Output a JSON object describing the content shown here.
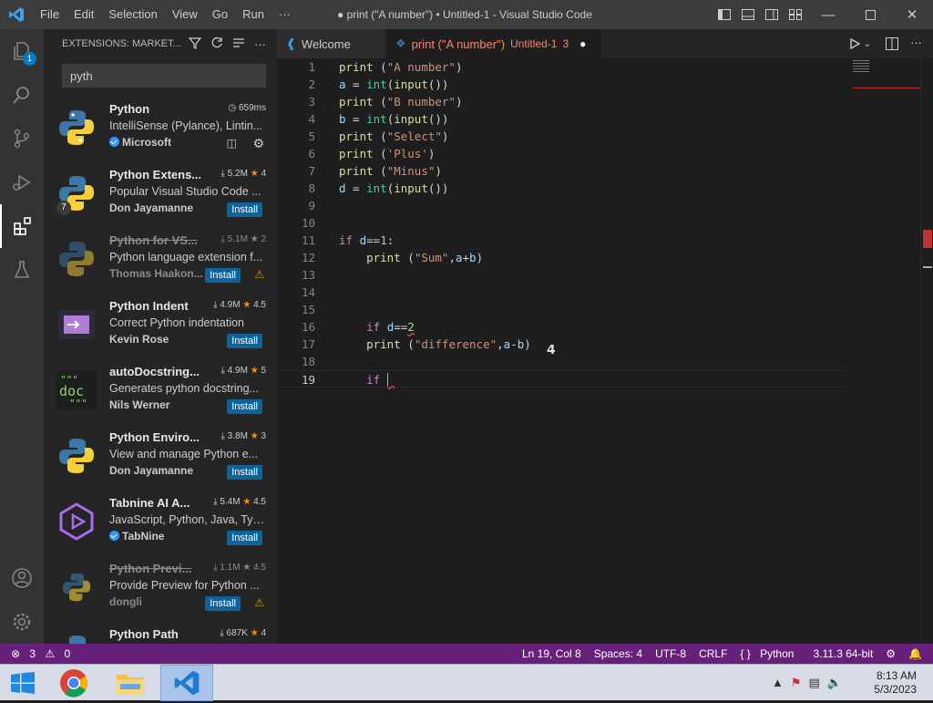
{
  "titlebar": {
    "menu": [
      "File",
      "Edit",
      "Selection",
      "View",
      "Go",
      "Run",
      "···"
    ],
    "window_title": "● print (\"A number\") • Untitled-1 - Visual Studio Code",
    "accent": "#3c3c3c"
  },
  "activity": {
    "explorer_badge": "1"
  },
  "sidebar": {
    "title": "EXTENSIONS: MARKET...",
    "search_value": "pyth",
    "extensions": [
      {
        "name": "Python",
        "meta": "659ms",
        "meta_icon": "clock-icon",
        "desc": "IntelliSense (Pylance), Lintin...",
        "publisher": "Microsoft",
        "verified": true,
        "installed": true
      },
      {
        "name": "Python Extens...",
        "downloads": "5.2M",
        "rating": "4",
        "desc": "Popular Visual Studio Code ...",
        "publisher": "Don Jayamanne",
        "install": "Install",
        "badge": "7"
      },
      {
        "name": "Python for VS...",
        "downloads": "5.1M",
        "rating": "2",
        "desc": "Python language extension f...",
        "publisher": "Thomas Haakon...",
        "install": "Install",
        "deprecated": true,
        "warning": true
      },
      {
        "name": "Python Indent",
        "downloads": "4.9M",
        "rating": "4.5",
        "desc": "Correct Python indentation",
        "publisher": "Kevin Rose",
        "install": "Install"
      },
      {
        "name": "autoDocstring...",
        "downloads": "4.9M",
        "rating": "5",
        "desc": "Generates python docstring...",
        "publisher": "Nils Werner",
        "install": "Install"
      },
      {
        "name": "Python Enviro...",
        "downloads": "3.8M",
        "rating": "3",
        "desc": "View and manage Python e...",
        "publisher": "Don Jayamanne",
        "install": "Install"
      },
      {
        "name": "Tabnine AI A...",
        "downloads": "5.4M",
        "rating": "4.5",
        "desc": "JavaScript, Python, Java, Typ...",
        "publisher": "TabNine",
        "verified": true,
        "install": "Install"
      },
      {
        "name": "Python Previ...",
        "downloads": "1.1M",
        "rating": "4.5",
        "desc": "Provide Preview for Python ...",
        "publisher": "dongli",
        "install": "Install",
        "deprecated": true,
        "warning": true
      },
      {
        "name": "Python Path",
        "downloads": "687K",
        "rating": "4"
      }
    ]
  },
  "tabs": [
    {
      "label": "Welcome"
    },
    {
      "label": "print (\"A number\")",
      "sub": "Untitled-1",
      "count": "3",
      "dirty": "●"
    }
  ],
  "editor": {
    "current_line": 19,
    "lines": [
      "print (\"A number\")",
      "a = int(input())",
      "print (\"B number\")",
      "b = int(input())",
      "print (\"Select\")",
      "print ('Plus')",
      "print (\"Minus\")",
      "d = int(input())",
      "",
      "",
      "if d==1:",
      "    print (\"Sum\",a+b)",
      "",
      "",
      "",
      "    if d==2",
      "    print (\"difference\",a-b)",
      "",
      "    if "
    ]
  },
  "statusbar": {
    "errors": "3",
    "warnings": "0",
    "position": "Ln 19, Col 8",
    "spaces": "Spaces: 4",
    "encoding": "UTF-8",
    "eol": "CRLF",
    "language": "Python",
    "interpreter": "3.11.3 64-bit",
    "color": "#68217a"
  },
  "taskbar": {
    "time": "8:13 AM",
    "date": "5/3/2023"
  }
}
